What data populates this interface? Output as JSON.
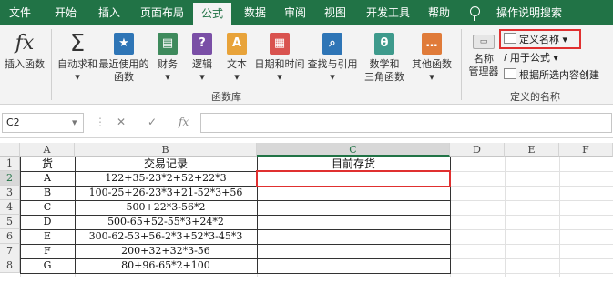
{
  "ribbon_tabs": [
    "文件",
    "开始",
    "插入",
    "页面布局",
    "公式",
    "数据",
    "审阅",
    "视图",
    "开发工具",
    "帮助",
    "操作说明搜索"
  ],
  "ribbon": {
    "function_library": [
      {
        "label1": "插入函数",
        "label2": "",
        "icon": "fx-icon"
      },
      {
        "label1": "自动求和",
        "label2": "",
        "icon": "sigma-icon"
      },
      {
        "label1": "最近使用的",
        "label2": "函数",
        "icon": "star-book-icon"
      },
      {
        "label1": "财务",
        "label2": "",
        "icon": "finance-book-icon"
      },
      {
        "label1": "逻辑",
        "label2": "",
        "icon": "question-book-icon"
      },
      {
        "label1": "文本",
        "label2": "",
        "icon": "text-book-icon"
      },
      {
        "label1": "日期和时间",
        "label2": "",
        "icon": "calendar-book-icon"
      },
      {
        "label1": "查找与引用",
        "label2": "",
        "icon": "search-book-icon"
      },
      {
        "label1": "数学和",
        "label2": "三角函数",
        "icon": "theta-book-icon"
      },
      {
        "label1": "其他函数",
        "label2": "",
        "icon": "more-book-icon"
      }
    ],
    "function_library_label": "函数库",
    "name_manager_1": "名称",
    "name_manager_2": "管理器",
    "define_name": "定义名称",
    "use_in_formula": "用于公式",
    "create_from_selection": "根据所选内容创建",
    "defined_names_label": "定义的名称"
  },
  "formula_bar": {
    "name_box": "C2",
    "cancel": "✕",
    "enter": "✓",
    "fx": "fx",
    "value": ""
  },
  "columns": [
    "A",
    "B",
    "C",
    "D",
    "E",
    "F"
  ],
  "rows": [
    [
      "货",
      "交易记录",
      "目前存货"
    ],
    [
      "A",
      "122+35-23*2+52+22*3",
      ""
    ],
    [
      "B",
      "100-25+26-23*3+21-52*3+56",
      ""
    ],
    [
      "C",
      "500+22*3-56*2",
      ""
    ],
    [
      "D",
      "500-65+52-55*3+24*2",
      ""
    ],
    [
      "E",
      "300-62-53+56-2*3+52*3-45*3",
      ""
    ],
    [
      "F",
      "200+32+32*3-56",
      ""
    ],
    [
      "G",
      "80+96-65*2+100",
      ""
    ]
  ],
  "row_numbers": [
    "1",
    "2",
    "3",
    "4",
    "5",
    "6",
    "7",
    "8"
  ],
  "selected_cell": "C2",
  "accent": "#217346",
  "highlight": "#e03030"
}
